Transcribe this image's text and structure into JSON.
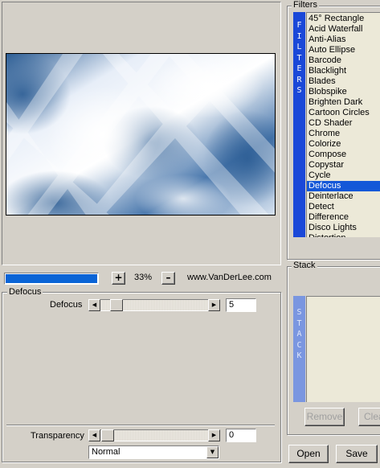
{
  "preview": {
    "colors": {
      "dark": "#2c5d94",
      "mid": "#6f9ccb",
      "light": "#ffffff"
    }
  },
  "toolbar": {
    "progress_percent": 100,
    "zoom_in_label": "+",
    "zoom_value": "33%",
    "zoom_out_label": "–",
    "website": "www.VanDerLee.com"
  },
  "filter_group": {
    "legend": "Defocus",
    "params": [
      {
        "label": "Defocus",
        "value": "5"
      }
    ]
  },
  "transparency": {
    "label": "Transparency",
    "value": "0",
    "blend_mode": "Normal"
  },
  "filters": {
    "legend": "Filters",
    "side_letters": [
      "F",
      "I",
      "L",
      "T",
      "E",
      "R",
      "S"
    ],
    "items": [
      "45° Rectangle",
      "Acid Waterfall",
      "Anti-Alias",
      "Auto Ellipse",
      "Barcode",
      "Blacklight",
      "Blades",
      "Blobspike",
      "Brighten Dark",
      "Cartoon Circles",
      "CD Shader",
      "Chrome",
      "Colorize",
      "Compose",
      "Copystar",
      "Cycle",
      "Defocus",
      "Deinterlace",
      "Detect",
      "Difference",
      "Disco Lights",
      "Distortion"
    ],
    "selected_index": 16
  },
  "stack": {
    "legend": "Stack",
    "side_letters": [
      "S",
      "T",
      "A",
      "C",
      "K"
    ],
    "remove_label": "Remove",
    "clear_label": "Clea"
  },
  "footer": {
    "open_label": "Open",
    "save_label": "Save"
  }
}
